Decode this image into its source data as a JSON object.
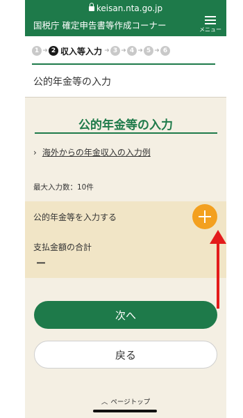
{
  "browser": {
    "url": "keisan.nta.go.jp"
  },
  "header": {
    "site_title": "国税庁 確定申告書等作成コーナー",
    "menu_label": "メニュー"
  },
  "steps": {
    "items": [
      "1",
      "2",
      "3",
      "4",
      "5",
      "6"
    ],
    "active_label": "収入等入力"
  },
  "section_title": "公的年金等の入力",
  "main": {
    "title": "公的年金等の入力",
    "link_text": "海外からの年金収入の入力例",
    "max_count": "最大入力数：10件",
    "add_label": "公的年金等を入力する",
    "total_label": "支払金額の合計",
    "total_value": "ー"
  },
  "buttons": {
    "next": "次へ",
    "back": "戻る"
  },
  "footer": {
    "page_top": "ページトップ"
  },
  "colors": {
    "brand_green": "#1e7a4a",
    "accent_orange": "#f3a01f",
    "annotation_red": "#e31b1b"
  }
}
